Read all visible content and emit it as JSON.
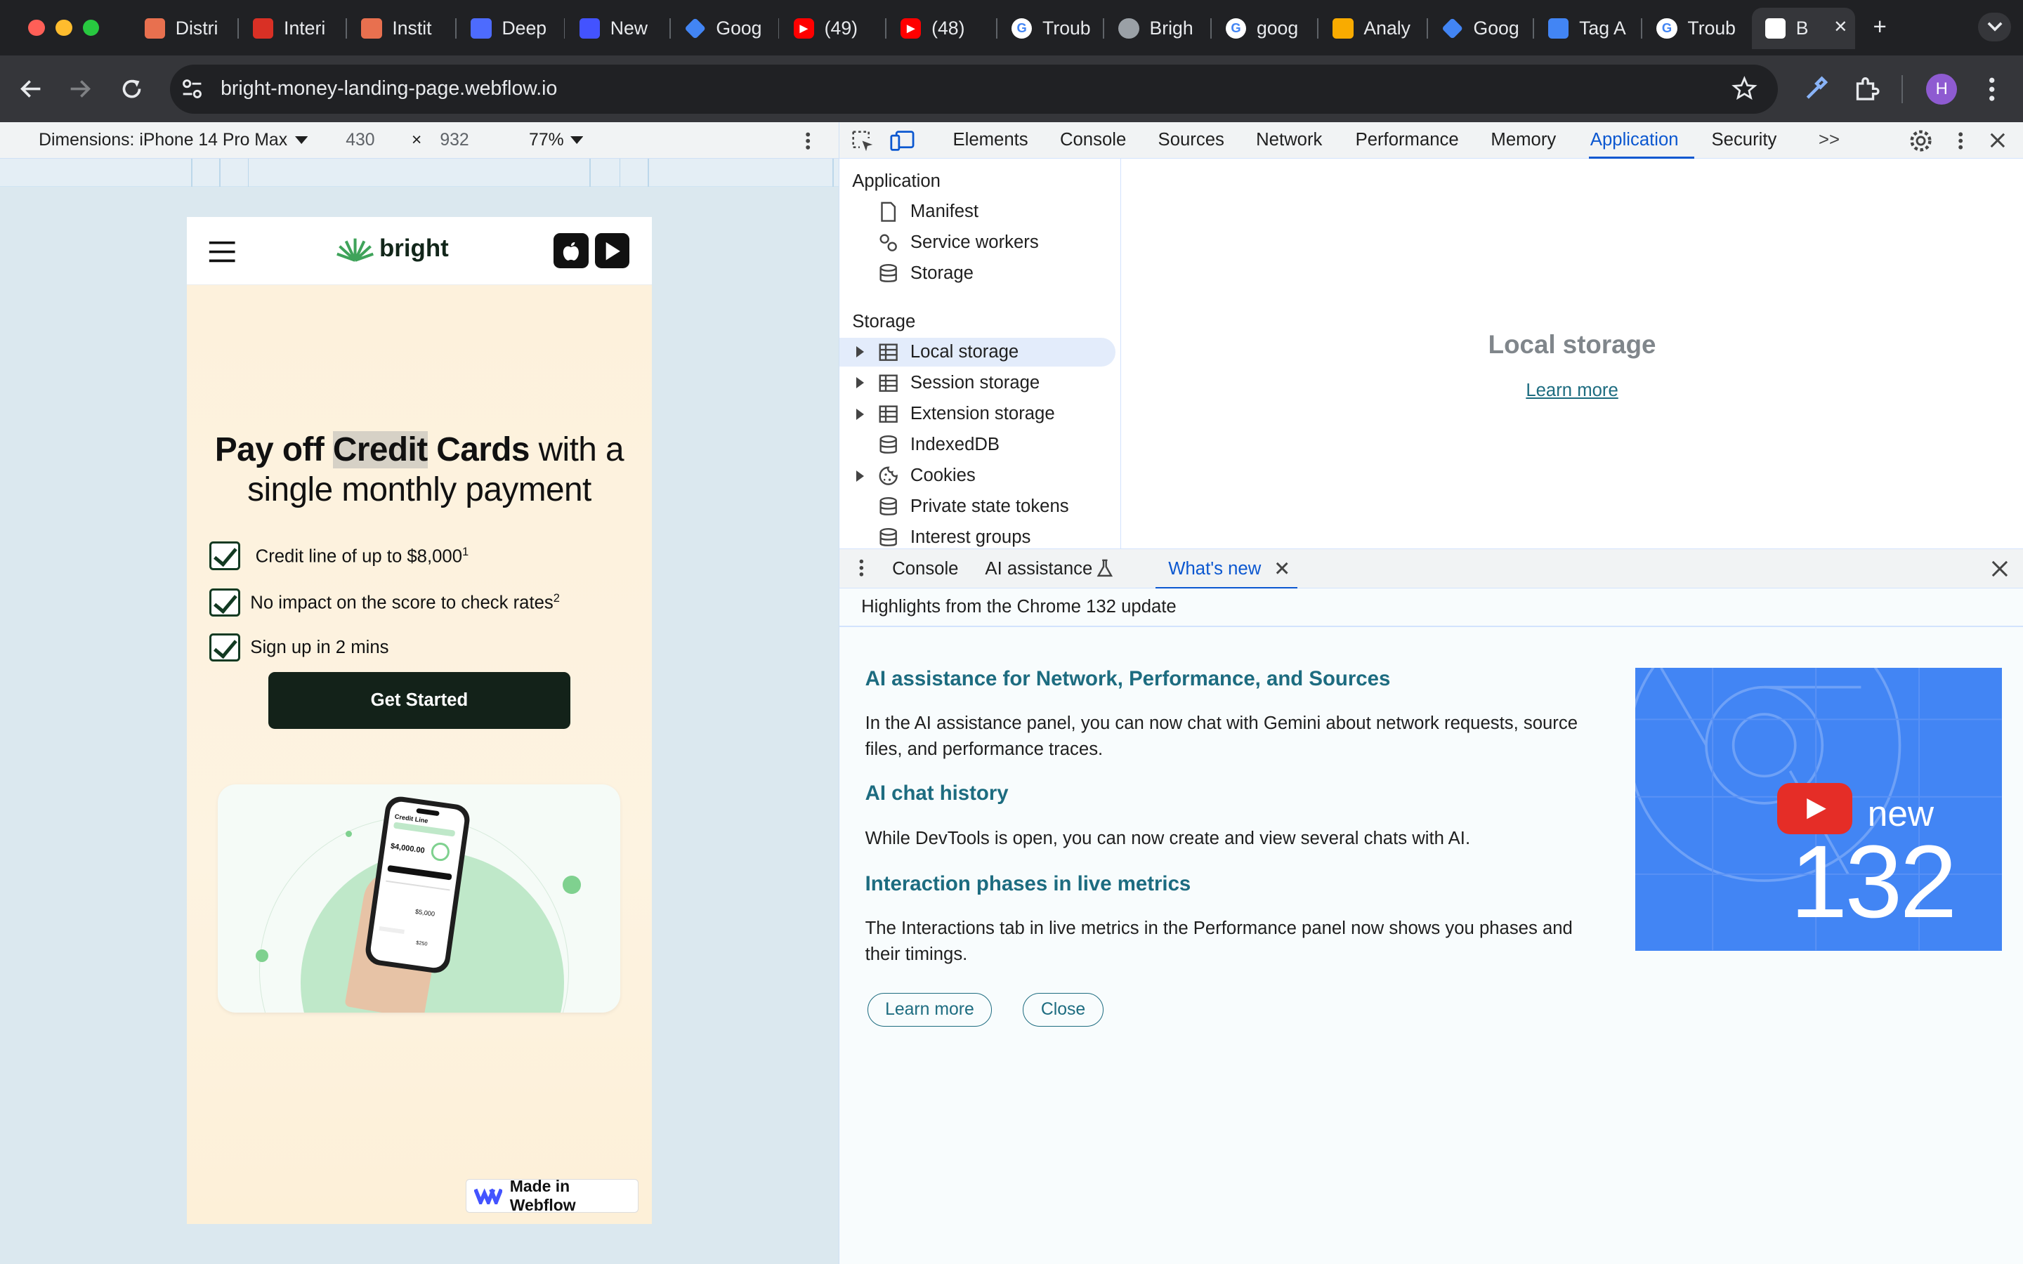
{
  "browser": {
    "tabs": [
      {
        "label": "Distri",
        "icon": "spark-icon",
        "color": "#e8704f"
      },
      {
        "label": "Interi",
        "icon": "gauge-icon",
        "color": "#d93025"
      },
      {
        "label": "Instit",
        "icon": "spark-icon",
        "color": "#e8704f"
      },
      {
        "label": "Deep",
        "icon": "whale-icon",
        "color": "#4d6bfe"
      },
      {
        "label": "New",
        "icon": "webflow-icon",
        "color": "#4353ff"
      },
      {
        "label": "Goog",
        "icon": "diamond-icon",
        "color": "#4285f4"
      },
      {
        "label": "(49)",
        "icon": "youtube-icon",
        "color": "#ff0000"
      },
      {
        "label": "(48)",
        "icon": "youtube-icon",
        "color": "#ff0000"
      },
      {
        "label": "Troub",
        "icon": "google-icon",
        "color": "#ffffff"
      },
      {
        "label": "Brigh",
        "icon": "globe-icon",
        "color": "#9aa0a6"
      },
      {
        "label": "goog",
        "icon": "google-icon",
        "color": "#ffffff"
      },
      {
        "label": "Analy",
        "icon": "analytics-icon",
        "color": "#f9ab00"
      },
      {
        "label": "Goog",
        "icon": "diamond-icon",
        "color": "#4285f4"
      },
      {
        "label": "Tag A",
        "icon": "tag-icon",
        "color": "#4285f4"
      },
      {
        "label": "Troub",
        "icon": "google-icon",
        "color": "#ffffff"
      },
      {
        "label": "B",
        "icon": "webflow-icon",
        "color": "#ffffff"
      }
    ],
    "new_tab": "+",
    "url": "bright-money-landing-page.webflow.io",
    "profile_initial": "H"
  },
  "device_toolbar": {
    "dimensions_label": "Dimensions: iPhone 14 Pro Max",
    "width": "430",
    "times": "×",
    "height": "932",
    "zoom": "77%"
  },
  "site": {
    "brand": "bright",
    "headline_part1": "Pay off ",
    "headline_highlight": "Credit",
    "headline_part2": " Cards",
    "headline_part3": " with a",
    "headline_line2": "single monthly payment",
    "features": [
      {
        "text": "Credit line of up to $8,000",
        "sup": "1"
      },
      {
        "text": "No impact on the score to check rates",
        "sup": "2"
      },
      {
        "text": "Sign up in 2 mins",
        "sup": ""
      }
    ],
    "cta": "Get Started",
    "phone_card": {
      "title": "Credit Line",
      "amount": "$4,000.00",
      "side_amount": "$5,000",
      "small_amount": "$250"
    },
    "badge": "Made in Webflow"
  },
  "devtools": {
    "tabs": [
      "Elements",
      "Console",
      "Sources",
      "Network",
      "Performance",
      "Memory",
      "Application",
      "Security"
    ],
    "more": ">>",
    "active_tab": "Application",
    "sidebar": {
      "section_application": "Application",
      "application_items": [
        "Manifest",
        "Service workers",
        "Storage"
      ],
      "section_storage": "Storage",
      "storage_items": [
        "Local storage",
        "Session storage",
        "Extension storage",
        "IndexedDB",
        "Cookies",
        "Private state tokens",
        "Interest groups"
      ]
    },
    "main": {
      "title": "Local storage",
      "link": "Learn more"
    },
    "drawer": {
      "tabs": [
        "Console",
        "AI assistance",
        "What's new"
      ],
      "subtitle": "Highlights from the Chrome 132 update",
      "sections": [
        {
          "heading": "AI assistance for Network, Performance, and Sources",
          "body": "In the AI assistance panel, you can now chat with Gemini about network requests, source files, and performance traces."
        },
        {
          "heading": "AI chat history",
          "body": "While DevTools is open, you can now create and view several chats with AI."
        },
        {
          "heading": "Interaction phases in live metrics",
          "body": "The Interactions tab in live metrics in the Performance panel now shows you phases and their timings."
        }
      ],
      "learn_more": "Learn more",
      "close": "Close",
      "thumb_new": "new",
      "thumb_version": "132"
    }
  }
}
